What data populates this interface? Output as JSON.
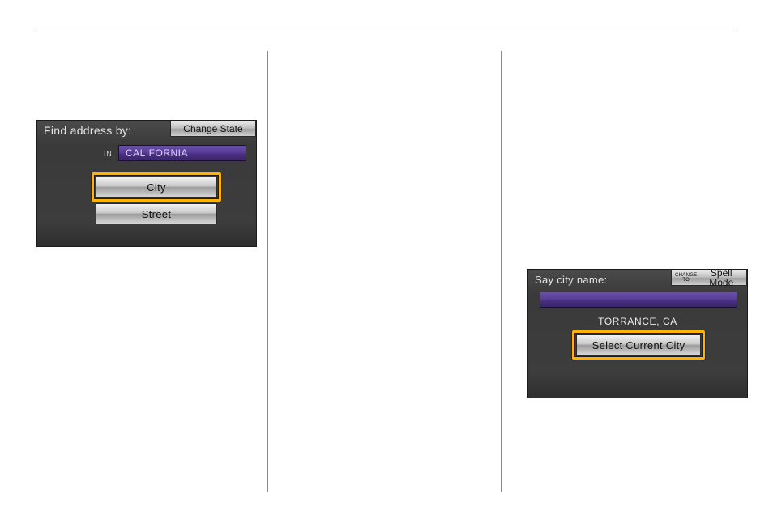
{
  "deviceA": {
    "prompt": "Find address by:",
    "change_btn": "Change State",
    "in_label": "IN",
    "state_value": "CALIFORNIA",
    "city_btn": "City",
    "street_btn": "Street"
  },
  "deviceB": {
    "prompt": "Say city name:",
    "change_super_line1": "CHANGE",
    "change_super_line2": "TO",
    "change_btn": "Spell Mode",
    "input_value": "",
    "current_city": "TORRANCE, CA",
    "select_btn": "Select Current City"
  }
}
